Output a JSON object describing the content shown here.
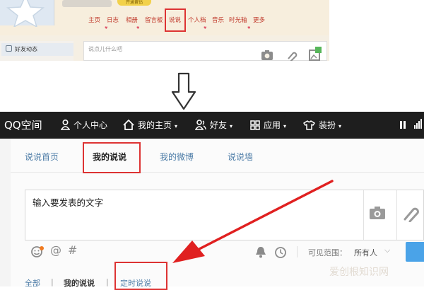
{
  "old_ui": {
    "tag": "开通黄钻",
    "nav": [
      "主页",
      "日志",
      "相册",
      "留言板",
      "说说",
      "个人档",
      "音乐",
      "时光轴",
      "更多"
    ],
    "highlighted_nav": "说说",
    "friends_feed": "好友动态",
    "input_placeholder": "说点儿什么吧"
  },
  "topbar": {
    "logo": "QQ空间",
    "items": [
      {
        "label": "个人中心",
        "icon": "person-icon",
        "caret": false
      },
      {
        "label": "我的主页",
        "icon": "home-icon",
        "caret": true
      },
      {
        "label": "好友",
        "icon": "friends-icon",
        "caret": true
      },
      {
        "label": "应用",
        "icon": "grid-icon",
        "caret": true
      },
      {
        "label": "装扮",
        "icon": "shirt-icon",
        "caret": true
      }
    ],
    "caret_glyph": "▾"
  },
  "tabs": [
    "说说首页",
    "我的说说",
    "我的微博",
    "说说墙"
  ],
  "active_tab": "我的说说",
  "editor": {
    "text": "输入要发表的文字",
    "at_symbol": "@",
    "hash_symbol": "#"
  },
  "visibility": {
    "label": "可见范围：",
    "value": "所有人",
    "caret": "⌵"
  },
  "subtabs": [
    "全部",
    "我的说说",
    "定时说说"
  ],
  "subtab_separator": "|",
  "watermark": "爱创根知识网",
  "colors": {
    "highlight_red": "#dd3333",
    "topbar_bg": "#1e1e1e",
    "link_blue": "#4f7ea8",
    "publish_blue": "#4aa3e8"
  }
}
